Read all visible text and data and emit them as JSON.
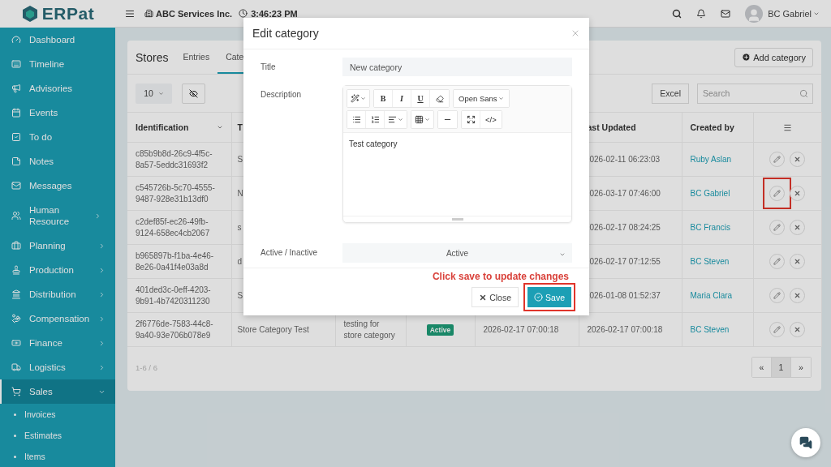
{
  "header": {
    "logo": "ERPat",
    "company": "ABC Services Inc.",
    "time": "3:46:23 PM",
    "user": "BC Gabriel"
  },
  "sidebar": {
    "items": [
      {
        "label": "Dashboard",
        "kind": "link",
        "selected": false
      },
      {
        "label": "Timeline",
        "kind": "link",
        "selected": false
      },
      {
        "label": "Advisories",
        "kind": "link",
        "selected": false
      },
      {
        "label": "Events",
        "kind": "link",
        "selected": false
      },
      {
        "label": "To do",
        "kind": "link",
        "selected": false
      },
      {
        "label": "Notes",
        "kind": "link",
        "selected": false
      },
      {
        "label": "Messages",
        "kind": "link",
        "selected": false
      },
      {
        "label": "Human Resource",
        "kind": "group",
        "selected": false,
        "expanded": false
      },
      {
        "label": "Planning",
        "kind": "group",
        "selected": false,
        "expanded": false
      },
      {
        "label": "Production",
        "kind": "group",
        "selected": false,
        "expanded": false
      },
      {
        "label": "Distribution",
        "kind": "group",
        "selected": false,
        "expanded": false
      },
      {
        "label": "Compensation",
        "kind": "group",
        "selected": false,
        "expanded": false
      },
      {
        "label": "Finance",
        "kind": "group",
        "selected": false,
        "expanded": false
      },
      {
        "label": "Logistics",
        "kind": "group",
        "selected": false,
        "expanded": false
      },
      {
        "label": "Sales",
        "kind": "group",
        "selected": true,
        "expanded": true,
        "children": [
          {
            "label": "Invoices"
          },
          {
            "label": "Estimates"
          },
          {
            "label": "Items"
          }
        ]
      }
    ]
  },
  "page": {
    "title": "Stores",
    "tabs": [
      {
        "label": "Entries",
        "selected": false
      },
      {
        "label": "Cate",
        "selected": true
      }
    ],
    "add_button": "Add category",
    "page_size": "10",
    "excel_button": "Excel",
    "search": {
      "placeholder": "Search"
    },
    "table": {
      "columns": [
        {
          "label": "Identification",
          "sortable": true
        },
        {
          "label": "T"
        },
        {},
        {},
        {},
        {
          "label": "ast Updated"
        },
        {
          "label": "Created by"
        },
        {
          "kind": "menu"
        }
      ],
      "rows": [
        {
          "id": "c85b9b8d-26c9-4f5c-8a57-5eddc31693f2",
          "title": "S",
          "updated": "026-02-11 06:23:03",
          "created_by": "Ruby Aslan",
          "highlighted": false
        },
        {
          "id": "c545726b-5c70-4555-9487-928e31b13df0",
          "title": "N",
          "updated": "026-03-17 07:46:00",
          "created_by": "BC Gabriel",
          "highlighted": true
        },
        {
          "id": "c2def85f-ec26-49fb-9124-658ec4cb2067",
          "title": "s",
          "updated": "026-02-17 08:24:25",
          "created_by": "BC Francis",
          "highlighted": false
        },
        {
          "id": "b965897b-f1ba-4e46-8e26-0a41f4e03a8d",
          "title": "d",
          "updated": "026-02-17 07:12:55",
          "created_by": "BC Steven",
          "highlighted": false
        },
        {
          "id": "401ded3c-0eff-4203-9b91-4b7420311230",
          "title": "S",
          "updated": "026-01-08 01:52:37",
          "created_by": "Maria Clara",
          "highlighted": false
        },
        {
          "id": "2f6776de-7583-44c8-9a40-93e706b078e9",
          "title": "Store Category Test",
          "description": "testing for store category",
          "status": "Active",
          "created": "2026-02-17 07:00:18",
          "updated": "2026-02-17 07:00:18",
          "created_by": "BC Steven",
          "highlighted": false
        }
      ]
    },
    "pagination": {
      "summary": "1-6 / 6",
      "prev": "«",
      "pages": [
        {
          "label": "1",
          "selected": true
        }
      ],
      "next": "»"
    }
  },
  "modal": {
    "title": "Edit category",
    "fields": [
      {
        "kind": "text",
        "label": "Title",
        "value": "New category"
      },
      {
        "kind": "editor",
        "label": "Description",
        "value": "Test category",
        "toolbar": {
          "bold": "B",
          "italic": "I",
          "underline": "U",
          "font": "Open Sans",
          "code": "</>"
        }
      },
      {
        "kind": "select",
        "label": "Active / Inactive",
        "value": "Active"
      }
    ],
    "annotation": "Click save to update changes",
    "buttons": [
      {
        "kind": "close",
        "label": "Close",
        "highlighted": false
      },
      {
        "kind": "save",
        "label": "Save",
        "highlighted": true
      }
    ]
  }
}
